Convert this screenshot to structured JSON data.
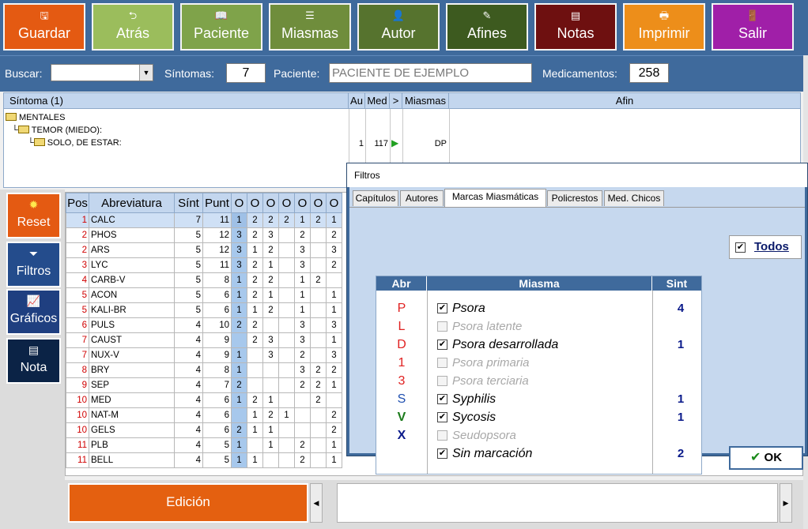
{
  "toolbar": {
    "buttons": [
      {
        "label": "Guardar",
        "icon": "save-icon",
        "color": "#e45a12"
      },
      {
        "label": "Atrás",
        "icon": "back-icon",
        "color": "#9bbd5c"
      },
      {
        "label": "Paciente",
        "icon": "patient-book-icon",
        "color": "#7fa34a"
      },
      {
        "label": "Miasmas",
        "icon": "list-icon",
        "color": "#6f8d3c"
      },
      {
        "label": "Autor",
        "icon": "author-icon",
        "color": "#56732e"
      },
      {
        "label": "Afines",
        "icon": "related-icon",
        "color": "#3d5a1f"
      },
      {
        "label": "Notas",
        "icon": "notes-icon",
        "color": "#6e1010"
      },
      {
        "label": "Imprimir",
        "icon": "print-icon",
        "color": "#ed8e1a"
      },
      {
        "label": "Salir",
        "icon": "exit-door-icon",
        "color": "#a01fa8"
      }
    ]
  },
  "search": {
    "buscar_label": "Buscar:",
    "buscar_value": "",
    "sintomas_label": "Síntomas:",
    "sintomas_value": "7",
    "paciente_label": "Paciente:",
    "paciente_value": "PACIENTE DE EJEMPLO",
    "medicamentos_label": "Medicamentos:",
    "medicamentos_value": "258"
  },
  "symptoms": {
    "headers": {
      "sintoma": "Síntoma (1)",
      "au": "Au",
      "med": "Med",
      "arrow": ">",
      "miasmas": "Miasmas",
      "afin": "Afin"
    },
    "tree": [
      "MENTALES",
      "TEMOR (MIEDO):",
      "SOLO, DE ESTAR:"
    ],
    "row": {
      "au": "1",
      "med": "117",
      "miasmas": "DP"
    }
  },
  "sidebar": {
    "reset": "Reset",
    "filtros": "Filtros",
    "graficos": "Gráficos",
    "nota": "Nota"
  },
  "remedies": {
    "headers": {
      "pos": "Pos",
      "abrev": "Abreviatura",
      "sint": "Sínt",
      "punt": "Punt",
      "o": "O"
    },
    "rows": [
      {
        "pos": "1",
        "ab": "CALC",
        "sint": "7",
        "punt": "11",
        "v": [
          "1",
          "2",
          "2",
          "2",
          "1",
          "2",
          "1"
        ]
      },
      {
        "pos": "2",
        "ab": "PHOS",
        "sint": "5",
        "punt": "12",
        "v": [
          "3",
          "2",
          "3",
          "",
          "2",
          "",
          "2"
        ]
      },
      {
        "pos": "2",
        "ab": "ARS",
        "sint": "5",
        "punt": "12",
        "v": [
          "3",
          "1",
          "2",
          "",
          "3",
          "",
          "3"
        ]
      },
      {
        "pos": "3",
        "ab": "LYC",
        "sint": "5",
        "punt": "11",
        "v": [
          "3",
          "2",
          "1",
          "",
          "3",
          "",
          "2"
        ]
      },
      {
        "pos": "4",
        "ab": "CARB-V",
        "sint": "5",
        "punt": "8",
        "v": [
          "1",
          "2",
          "2",
          "",
          "1",
          "2",
          ""
        ]
      },
      {
        "pos": "5",
        "ab": "ACON",
        "sint": "5",
        "punt": "6",
        "v": [
          "1",
          "2",
          "1",
          "",
          "1",
          "",
          "1"
        ]
      },
      {
        "pos": "5",
        "ab": "KALI-BR",
        "sint": "5",
        "punt": "6",
        "v": [
          "1",
          "1",
          "2",
          "",
          "1",
          "",
          "1"
        ]
      },
      {
        "pos": "6",
        "ab": "PULS",
        "sint": "4",
        "punt": "10",
        "v": [
          "2",
          "2",
          "",
          "",
          "3",
          "",
          "3"
        ]
      },
      {
        "pos": "7",
        "ab": "CAUST",
        "sint": "4",
        "punt": "9",
        "v": [
          "",
          "2",
          "3",
          "",
          "3",
          "",
          "1"
        ]
      },
      {
        "pos": "7",
        "ab": "NUX-V",
        "sint": "4",
        "punt": "9",
        "v": [
          "1",
          "",
          "3",
          "",
          "2",
          "",
          "3"
        ]
      },
      {
        "pos": "8",
        "ab": "BRY",
        "sint": "4",
        "punt": "8",
        "v": [
          "1",
          "",
          "",
          "",
          "3",
          "2",
          "2"
        ]
      },
      {
        "pos": "9",
        "ab": "SEP",
        "sint": "4",
        "punt": "7",
        "v": [
          "2",
          "",
          "",
          "",
          "2",
          "2",
          "1"
        ]
      },
      {
        "pos": "10",
        "ab": "MED",
        "sint": "4",
        "punt": "6",
        "v": [
          "1",
          "2",
          "1",
          "",
          "",
          "2",
          ""
        ]
      },
      {
        "pos": "10",
        "ab": "NAT-M",
        "sint": "4",
        "punt": "6",
        "v": [
          "",
          "1",
          "2",
          "1",
          "",
          "",
          "2"
        ]
      },
      {
        "pos": "10",
        "ab": "GELS",
        "sint": "4",
        "punt": "6",
        "v": [
          "2",
          "1",
          "1",
          "",
          "",
          "",
          "2"
        ]
      },
      {
        "pos": "11",
        "ab": "PLB",
        "sint": "4",
        "punt": "5",
        "v": [
          "1",
          "",
          "1",
          "",
          "2",
          "",
          "1"
        ]
      },
      {
        "pos": "11",
        "ab": "BELL",
        "sint": "4",
        "punt": "5",
        "v": [
          "1",
          "1",
          "",
          "",
          "2",
          "",
          "1"
        ]
      }
    ]
  },
  "bottom": {
    "edicion": "Edición"
  },
  "dialog": {
    "title": "Filtros",
    "tabs": [
      "Capítulos",
      "Autores",
      "Marcas Miasmáticas",
      "Policrestos",
      "Med. Chicos"
    ],
    "active_tab": "Marcas Miasmáticas",
    "todos": "Todos",
    "headers": {
      "abr": "Abr",
      "miasma": "Miasma",
      "sint": "Sint"
    },
    "rows": [
      {
        "abr": "P",
        "abr_color": "#e02020",
        "name": "Psora",
        "checked": true,
        "enabled": true,
        "sint": "4"
      },
      {
        "abr": "L",
        "abr_color": "#e02020",
        "name": "Psora latente",
        "checked": false,
        "enabled": false,
        "sint": ""
      },
      {
        "abr": "D",
        "abr_color": "#e02020",
        "name": "Psora desarrollada",
        "checked": true,
        "enabled": true,
        "sint": "1"
      },
      {
        "abr": "1",
        "abr_color": "#e02020",
        "name": "Psora primaria",
        "checked": false,
        "enabled": false,
        "sint": ""
      },
      {
        "abr": "3",
        "abr_color": "#e02020",
        "name": "Psora terciaria",
        "checked": false,
        "enabled": false,
        "sint": ""
      },
      {
        "abr": "S",
        "abr_color": "#1f4fb0",
        "name": "Syphilis",
        "checked": true,
        "enabled": true,
        "sint": "1"
      },
      {
        "abr": "V",
        "abr_color": "#1a7a1a",
        "name": "Sycosis",
        "checked": true,
        "enabled": true,
        "sint": "1"
      },
      {
        "abr": "X",
        "abr_color": "#0a1a8a",
        "name": "Seudopsora",
        "checked": false,
        "enabled": false,
        "sint": ""
      },
      {
        "abr": "",
        "abr_color": "#000000",
        "name": "Sin marcación",
        "checked": true,
        "enabled": true,
        "sint": "2"
      }
    ],
    "ok": "OK"
  }
}
